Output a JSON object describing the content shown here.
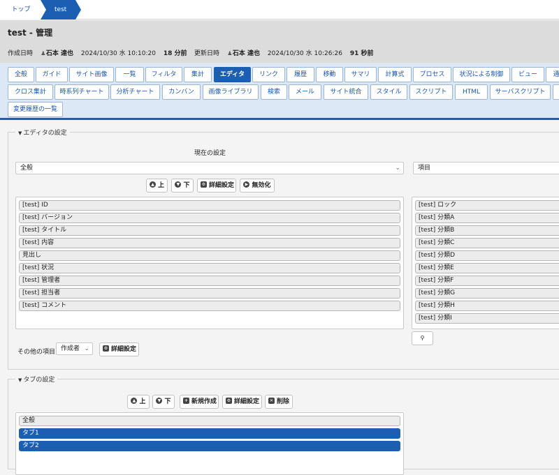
{
  "breadcrumb": {
    "top": "トップ",
    "current": "test"
  },
  "header": {
    "title": "test - 管理",
    "created_label": "作成日時",
    "created_user": "石本 達也",
    "created_time": "2024/10/30 水 10:10:20",
    "created_ago": "18 分前",
    "updated_label": "更新日時",
    "updated_user": "石本 達也",
    "updated_time": "2024/10/30 水 10:26:26",
    "updated_ago": "91 秒前"
  },
  "tabs": {
    "row1": [
      "全般",
      "ガイド",
      "サイト画像",
      "一覧",
      "フィルタ",
      "集計",
      "エディタ",
      "リンク",
      "履歴",
      "移動",
      "サマリ",
      "計算式",
      "プロセス",
      "状況による制御",
      "ビュー",
      "通"
    ],
    "row2": [
      "クロス集計",
      "時系列チャート",
      "分析チャート",
      "カンバン",
      "画像ライブラリ",
      "検索",
      "メール",
      "サイト統合",
      "スタイル",
      "スクリプト",
      "HTML",
      "サーバスクリプト",
      ""
    ],
    "row3": [
      "変更履歴の一覧"
    ],
    "active": "エディタ"
  },
  "editor": {
    "legend": "エディタの設定",
    "current_label": "現在の設定",
    "current_select": "全般",
    "right_select": "項目",
    "buttons": {
      "up": "上",
      "down": "下",
      "detail": "詳細設定",
      "disable": "無効化"
    },
    "current_items": [
      "[test] ID",
      "[test] バージョン",
      "[test] タイトル",
      "[test] 内容",
      "見出し",
      "[test] 状況",
      "[test] 管理者",
      "[test] 担当者",
      "[test] コメント"
    ],
    "available_items": [
      "[test] ロック",
      "[test] 分類A",
      "[test] 分類B",
      "[test] 分類C",
      "[test] 分類D",
      "[test] 分類E",
      "[test] 分類F",
      "[test] 分類G",
      "[test] 分類H",
      "[test] 分類I"
    ],
    "other_label": "その他の項目",
    "other_select": "作成者",
    "other_detail": "詳細設定"
  },
  "tab_settings": {
    "legend": "タブの設定",
    "buttons": {
      "up": "上",
      "down": "下",
      "new": "新規作成",
      "detail": "詳細設定",
      "delete": "削除"
    },
    "items": [
      {
        "label": "全般",
        "selected": false
      },
      {
        "label": "タブ1",
        "selected": true
      },
      {
        "label": "タブ2",
        "selected": true
      }
    ]
  },
  "colors": {
    "accent": "#1c5fb2",
    "tabbar_bg": "#dce8f5",
    "header_bg": "#dcdcdc"
  }
}
